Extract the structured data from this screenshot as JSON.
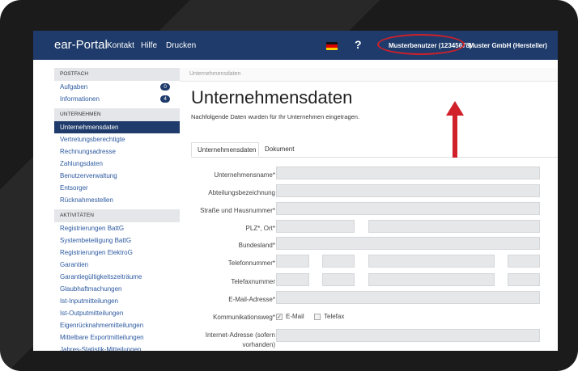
{
  "nav": {
    "brand": "ear-Portal",
    "links": [
      "Kontakt",
      "Hilfe",
      "Drucken"
    ],
    "help_label": "?",
    "user": "Musterbenutzer (12345678)",
    "company": "Muster GmbH (Hersteller)"
  },
  "sidebar": {
    "postfach": {
      "heading": "POSTFACH",
      "items": [
        {
          "label": "Aufgaben",
          "count": "0"
        },
        {
          "label": "Informationen",
          "count": "4"
        }
      ]
    },
    "unternehmen": {
      "heading": "UNTERNEHMEN",
      "items": [
        "Unternehmensdaten",
        "Vertretungsberechtigte",
        "Rechnungsadresse",
        "Zahlungsdaten",
        "Benutzerverwaltung",
        "Entsorger",
        "Rücknahmestellen"
      ]
    },
    "aktivitaeten": {
      "heading": "AKTIVITÄTEN",
      "items": [
        "Registrierungen BattG",
        "Systembeteiligung BattG",
        "Registrierungen ElektroG",
        "Garantien",
        "Garantiegültigkeitszeiträume",
        "Glaubhaftmachungen",
        "Ist-Inputmitteilungen",
        "Ist-Outputmitteilungen",
        "Eigenrücknahmemitteilungen",
        "Mittelbare Exportmitteilungen",
        "Jahres-Statistik-Mitteilungen"
      ]
    }
  },
  "main": {
    "breadcrumb": "Unternehmensdaten",
    "title": "Unternehmensdaten",
    "subtitle": "Nachfolgende Daten wurden für Ihr Unternehmen eingetragen.",
    "tabs": [
      "Unternehmensdaten",
      "Dokument"
    ],
    "fields": {
      "unternehmensname": "Unternehmensname*",
      "abteilung": "Abteilungsbezeichnung",
      "strasse": "Straße und Hausnummer*",
      "plz_ort": "PLZ*, Ort*",
      "bundesland": "Bundesland*",
      "telefon": "Telefonnummer*",
      "telefax": "Telefaxnummer",
      "email": "E-Mail-Adresse*",
      "kommunikation": "Kommunikationsweg*",
      "kommunikation_options": [
        "E-Mail",
        "Telefax"
      ],
      "internet_line1": "Internet-Adresse (sofern",
      "internet_line2": "vorhanden)"
    }
  },
  "colors": {
    "nav_bg": "#1e3b6b",
    "link": "#2d5aa0",
    "highlight": "#d0202a"
  }
}
